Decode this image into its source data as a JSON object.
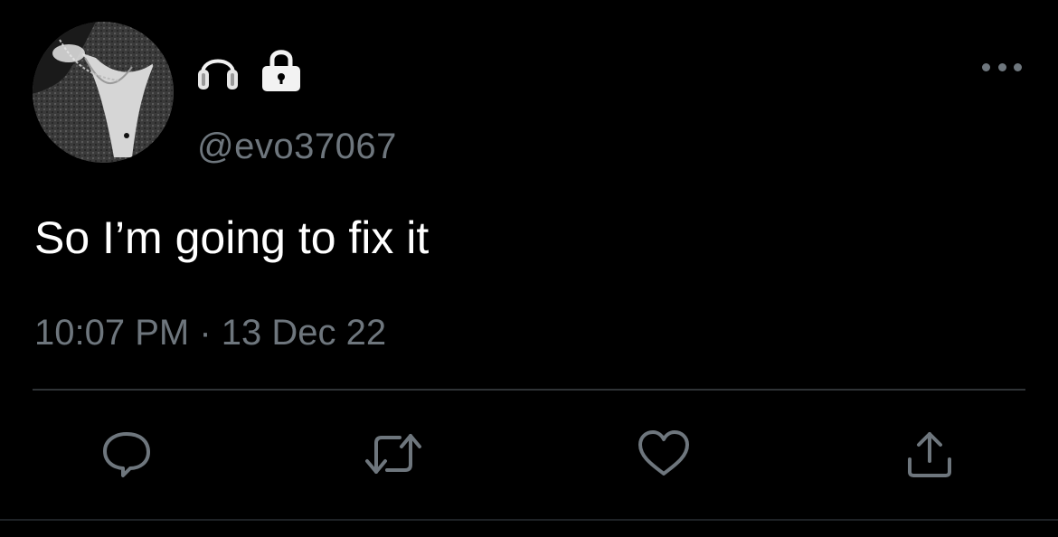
{
  "colors": {
    "background": "#000000",
    "text_primary": "#ffffff",
    "text_secondary": "#6e767d",
    "divider": "#2f3336"
  },
  "tweet": {
    "avatar": {
      "icon": "profile-photo"
    },
    "display_name_emojis": [
      "headphones-emoji",
      "lock-emoji"
    ],
    "handle": "@evo37067",
    "text": "So I’m going to fix it",
    "timestamp": "10:07 PM · 13 Dec 22",
    "more_icon": "ellipsis-icon",
    "actions": [
      {
        "name": "reply",
        "icon": "reply-icon"
      },
      {
        "name": "retweet",
        "icon": "retweet-icon"
      },
      {
        "name": "like",
        "icon": "heart-icon"
      },
      {
        "name": "share",
        "icon": "share-icon"
      }
    ]
  }
}
